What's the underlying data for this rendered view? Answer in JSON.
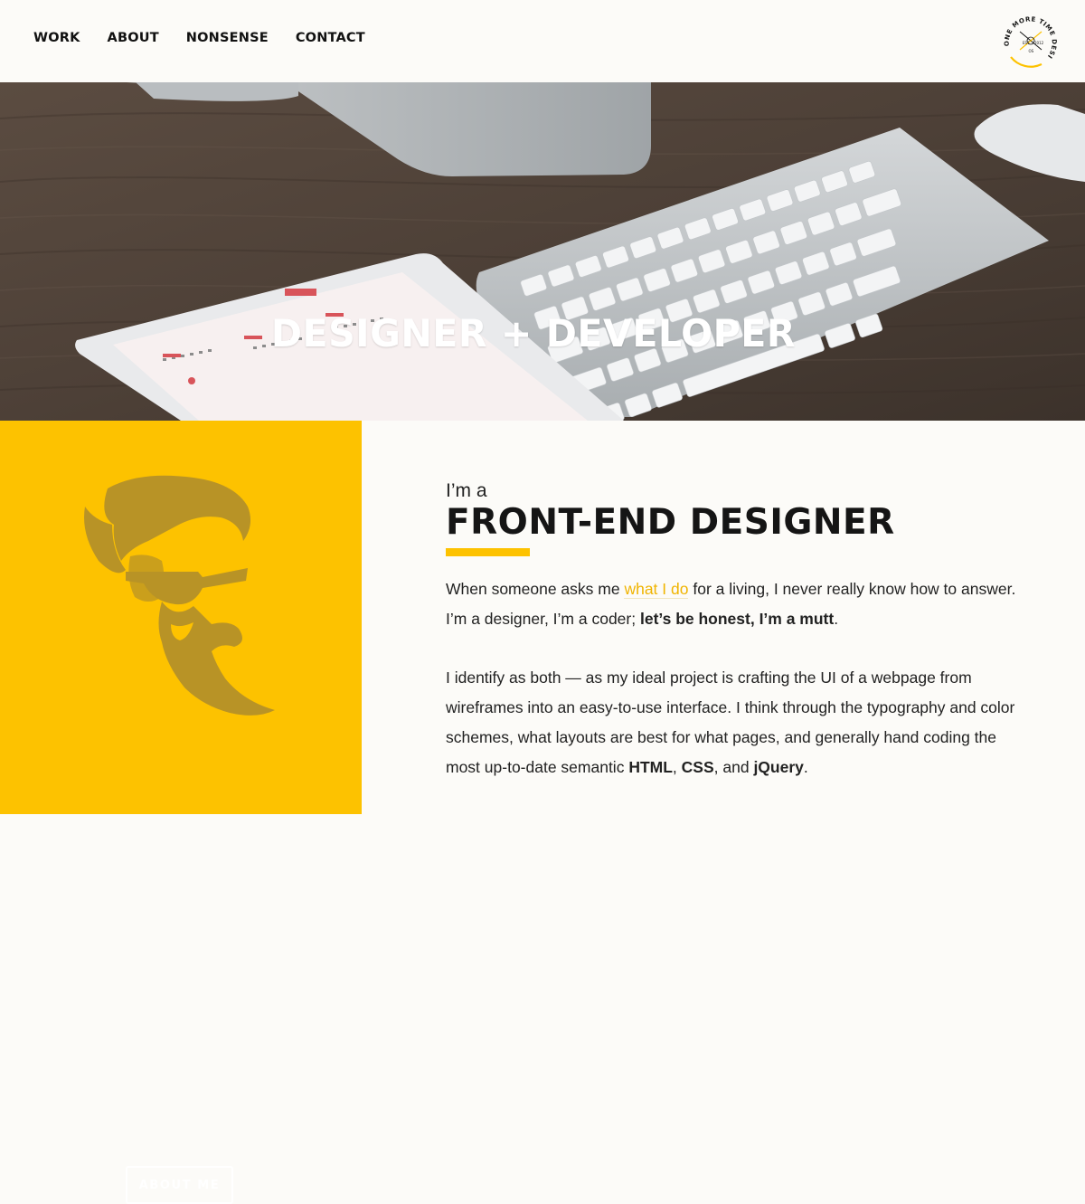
{
  "nav": {
    "items": [
      {
        "label": "WORK"
      },
      {
        "label": "ABOUT"
      },
      {
        "label": "NONSENSE"
      },
      {
        "label": "CONTACT"
      }
    ]
  },
  "logo": {
    "text_top": "ONE MORE TIME DESIGN",
    "text_center_top": "EST",
    "text_center_right": "2012",
    "text_center_bottom": "OS"
  },
  "hero": {
    "title": "DESIGNER + DEVELOPER"
  },
  "about_panel": {
    "button_label": "ABOUT ME",
    "accent_color": "#fdc200"
  },
  "content": {
    "intro": "I’m a",
    "headline": "FRONT-END DESIGNER",
    "p1": {
      "t1": "When someone asks me ",
      "link": "what I do",
      "t2": " for a living, I never really know how to answer. I’m a designer, I’m a coder; ",
      "bold": "let’s be honest, I’m a mutt",
      "t3": "."
    },
    "p2": {
      "t1": "I identify as both — as my ideal project is crafting the UI of a webpage from wireframes into an easy-to-use interface. I think through the typography and color schemes, what layouts are best for what pages, and generally hand coding the most up-to-date semantic ",
      "b1": "HTML",
      "t2": ", ",
      "b2": "CSS",
      "t3": ", and ",
      "b3": "jQuery",
      "t4": "."
    }
  }
}
